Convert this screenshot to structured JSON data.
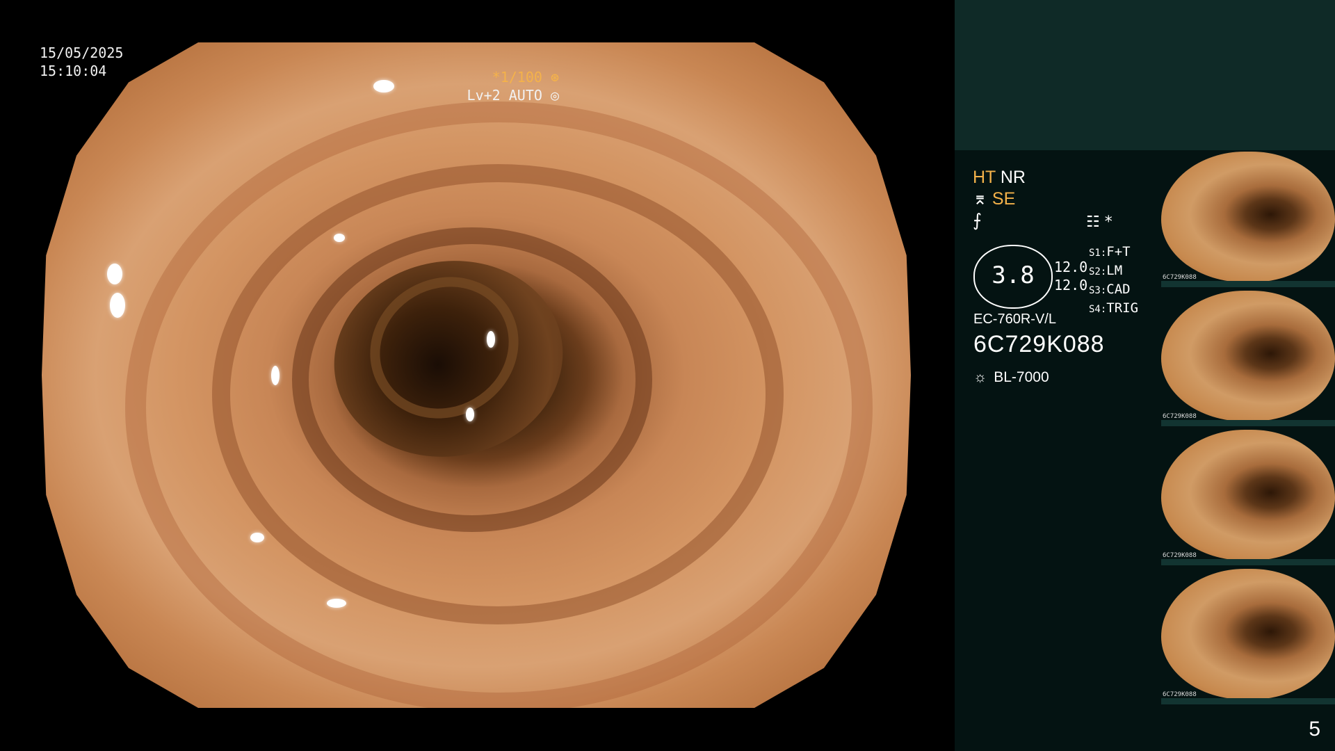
{
  "overlay": {
    "date": "15/05/2025",
    "time": "15:10:04",
    "shutter": "*1/100",
    "shutter_icon": "shutter-icon",
    "level": "Lv+2 AUTO",
    "auto_icon": "auto-icon"
  },
  "panel": {
    "mode_ht": "HT",
    "mode_nr": "NR",
    "mode_se": "SE",
    "se_icon": "structure-enhancement-icon",
    "ftc_icon": "filter-icon",
    "status_icon": "image-settings-icon",
    "asterisk": "*",
    "dial_value": "3.8",
    "dial_1": "12.0",
    "dial_2": "12.0",
    "settings": [
      {
        "key": "S1:",
        "value": "F+T"
      },
      {
        "key": "S2:",
        "value": "LM"
      },
      {
        "key": "S3:",
        "value": "CAD"
      },
      {
        "key": "S4:",
        "value": "TRIG"
      }
    ],
    "model": "EC-760R-V/L",
    "serial": "6C729K088",
    "light_source": "BL-7000",
    "light_icon": "light-source-icon"
  },
  "thumbnails": [
    {
      "label": "6C729K088"
    },
    {
      "label": "6C729K088"
    },
    {
      "label": "6C729K088"
    },
    {
      "label": "6C729K088"
    }
  ],
  "page_number": "5"
}
